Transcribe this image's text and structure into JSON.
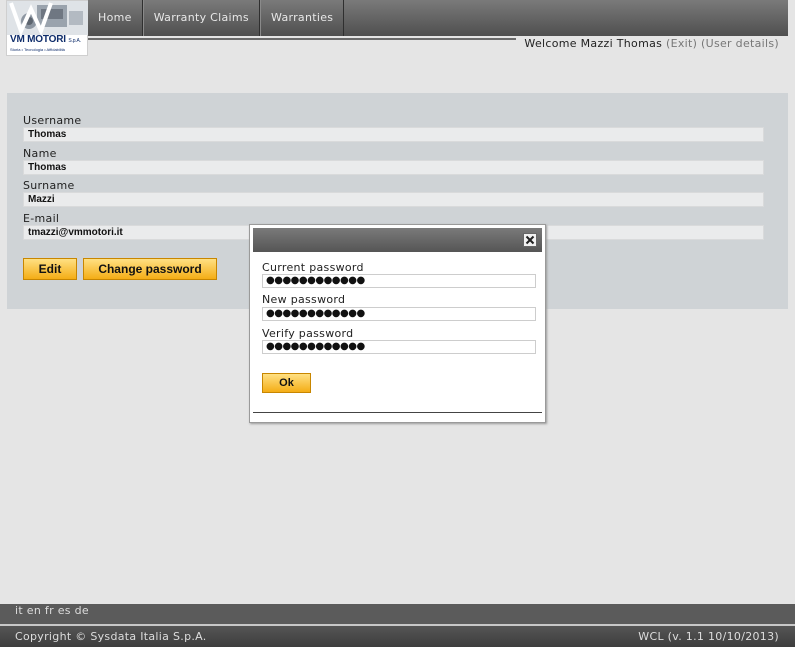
{
  "logo": {
    "name": "VM MOTORI",
    "suffix": "S.p.A.",
    "tagline": "Storia • Tecnologia • Affidabilità"
  },
  "nav": {
    "items": [
      "Home",
      "Warranty Claims",
      "Warranties"
    ]
  },
  "user_bar": {
    "welcome": "Welcome Mazzi Thomas",
    "exit": "(Exit)",
    "details": "(User details)"
  },
  "profile": {
    "username_label": "Username",
    "username_value": "Thomas",
    "name_label": "Name",
    "name_value": "Thomas",
    "surname_label": "Surname",
    "surname_value": "Mazzi",
    "email_label": "E-mail",
    "email_value": "tmazzi@vmmotori.it",
    "edit_label": "Edit",
    "change_password_label": "Change password"
  },
  "password_dialog": {
    "current_label": "Current password",
    "current_value": "●●●●●●●●●●●●",
    "new_label": "New password",
    "new_value": "●●●●●●●●●●●●",
    "verify_label": "Verify password",
    "verify_value": "●●●●●●●●●●●●",
    "ok_label": "Ok"
  },
  "footer": {
    "languages": "it en fr es de",
    "copyright": "Copyright © Sysdata Italia S.p.A.",
    "version": "WCL (v. 1.1 10/10/2013)"
  },
  "colors": {
    "button_top": "#ffe083",
    "button_bottom": "#f4ad16",
    "nav_bg": "#5f5f5f",
    "panel_bg": "#cfd3d6",
    "brand_blue": "#0f2d6b"
  },
  "icons": {
    "close": "close-icon"
  }
}
